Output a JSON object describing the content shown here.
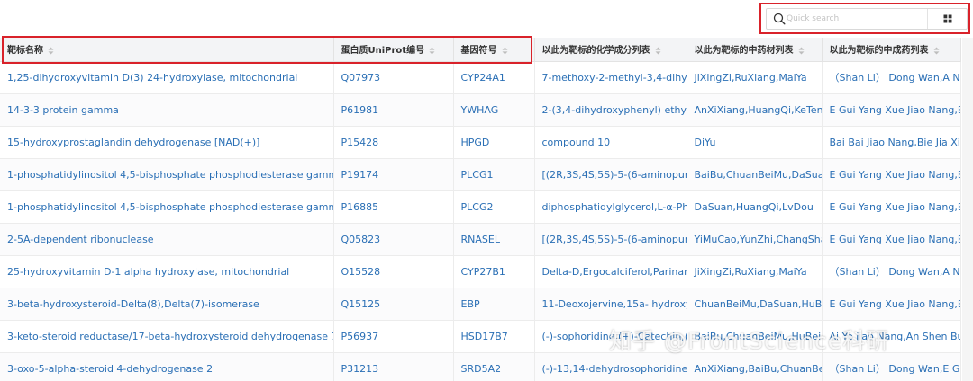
{
  "search": {
    "placeholder": "Quick search"
  },
  "columns": [
    "靶标名称",
    "蛋白质UniProt编号",
    "基因符号",
    "以此为靶标的化学成分列表",
    "以此为靶标的中药材列表",
    "以此为靶标的中成药列表"
  ],
  "rows": [
    [
      "1,25-dihydroxyvitamin D(3) 24-hydroxylase, mitochondrial",
      "Q07973",
      "CYP24A1",
      "7-methoxy-2-methyl-3,4-dihydr",
      "JiXingZi,RuXiang,MaiYa",
      "（Shan Li） Dong Wan,A Na"
    ],
    [
      "14-3-3 protein gamma",
      "P61981",
      "YWHAG",
      "2-(3,4-dihydroxyphenyl) ethyl ac",
      "AnXiXiang,HuangQi,KeTengZ",
      "E Gui Yang Xue Jiao Nang,E G"
    ],
    [
      "15-hydroxyprostaglandin dehydrogenase [NAD(+)]",
      "P15428",
      "HPGD",
      "compound 10",
      "DiYu",
      "Bai Bai Jiao Nang,Bie Jia Xiao"
    ],
    [
      "1-phosphatidylinositol 4,5-bisphosphate phosphodiesterase gamma-1",
      "P19174",
      "PLCG1",
      "[(2R,3S,4S,5S)-5-(6-aminopurin-",
      "BaiBu,ChuanBeiMu,DaSuan",
      "E Gui Yang Xue Jiao Nang,E G"
    ],
    [
      "1-phosphatidylinositol 4,5-bisphosphate phosphodiesterase gamma-2",
      "P16885",
      "PLCG2",
      "diphosphatidylglycerol,L-α-Phos",
      "DaSuan,HuangQi,LvDou",
      "E Gui Yang Xue Jiao Nang,E G"
    ],
    [
      "2-5A-dependent ribonuclease",
      "Q05823",
      "RNASEL",
      "[(2R,3S,4S,5S)-5-(6-aminopurin-",
      "YiMuCao,YunZhi,ChangShan",
      "E Gui Yang Xue Jiao Nang,E G"
    ],
    [
      "25-hydroxyvitamin D-1 alpha hydroxylase, mitochondrial",
      "O15528",
      "CYP27B1",
      "Delta-D,Ergocalciferol,Parinaric a",
      "JiXingZi,RuXiang,MaiYa",
      "（Shan Li） Dong Wan,A Na"
    ],
    [
      "3-beta-hydroxysteroid-Delta(8),Delta(7)-isomerase",
      "Q15125",
      "EBP",
      "11-Deoxojervine,15a- hydroxysc",
      "ChuanBeiMu,DaSuan,HuBeiB",
      "E Gui Yang Xue Jiao Nang,E G"
    ],
    [
      "3-keto-steroid reductase/17-beta-hydroxysteroid dehydrogenase 7",
      "P56937",
      "HSD17B7",
      "(-)-sophoridine,(+)-Catechin,(-",
      "BaiBu,ChuanBeiMu,HuBeiBe",
      "Ai Ye Jiao Nang,An Shen Bu"
    ],
    [
      "3-oxo-5-alpha-steroid 4-dehydrogenase 2",
      "P31213",
      "SRD5A2",
      "(-)-13,14-dehydrosophoridine,(-",
      "AnXiXiang,BaiBu,ChuanBeiM",
      "（Shan Li） Dong Wan,E Gu"
    ]
  ],
  "watermark": "知乎 @FrontScience科研"
}
